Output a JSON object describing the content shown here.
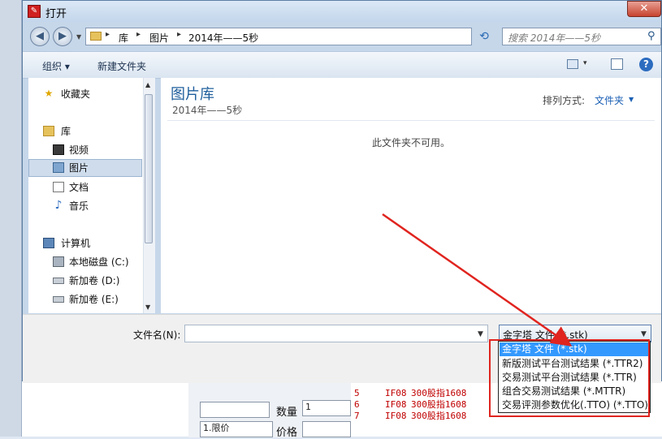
{
  "dialog": {
    "title": "打开",
    "close_label": "✕"
  },
  "address": {
    "crumbs": [
      "库",
      "图片",
      "2014年——5秒"
    ],
    "search_placeholder": "搜索 2014年——5秒"
  },
  "toolbar": {
    "organize": "组织 ▾",
    "new_folder": "新建文件夹"
  },
  "navpane": {
    "favorites": "收藏夹",
    "libraries": "库",
    "video": "视频",
    "pictures": "图片",
    "documents": "文档",
    "music": "音乐",
    "computer": "计算机",
    "drive_c": "本地磁盘 (C:)",
    "drive_d": "新加卷 (D:)",
    "drive_e": "新加卷 (E:)"
  },
  "content": {
    "library_title": "图片库",
    "library_sub": "2014年——5秒",
    "arrange_label": "排列方式:",
    "arrange_value": "文件夹",
    "empty_message": "此文件夹不可用。"
  },
  "bottom": {
    "filename_label": "文件名(N):",
    "filename_value": "",
    "filter_value": "金字塔 文件 (*.stk)"
  },
  "dropdown": {
    "items": [
      "金字塔 文件 (*.stk)",
      "新版测试平台测试结果 (*.TTR2)",
      "交易测试平台测试结果 (*.TTR)",
      "组合交易测试结果 (*.MTTR)",
      "交易评测参数优化(.TTO) (*.TTO)"
    ],
    "selected_index": 0
  },
  "background_app": {
    "quantity_label": "数量",
    "quantity_value": "1",
    "price_label": "价格",
    "order_type": "1.限价",
    "rows": [
      {
        "num": "5",
        "code": "IF08",
        "name": "300股指1608"
      },
      {
        "num": "6",
        "code": "IF08",
        "name": "300股指1608"
      },
      {
        "num": "7",
        "code": "IF08",
        "name": "300股指1608"
      }
    ]
  },
  "annotation_color": "#e0241f",
  "selection_color": "#3399ff"
}
